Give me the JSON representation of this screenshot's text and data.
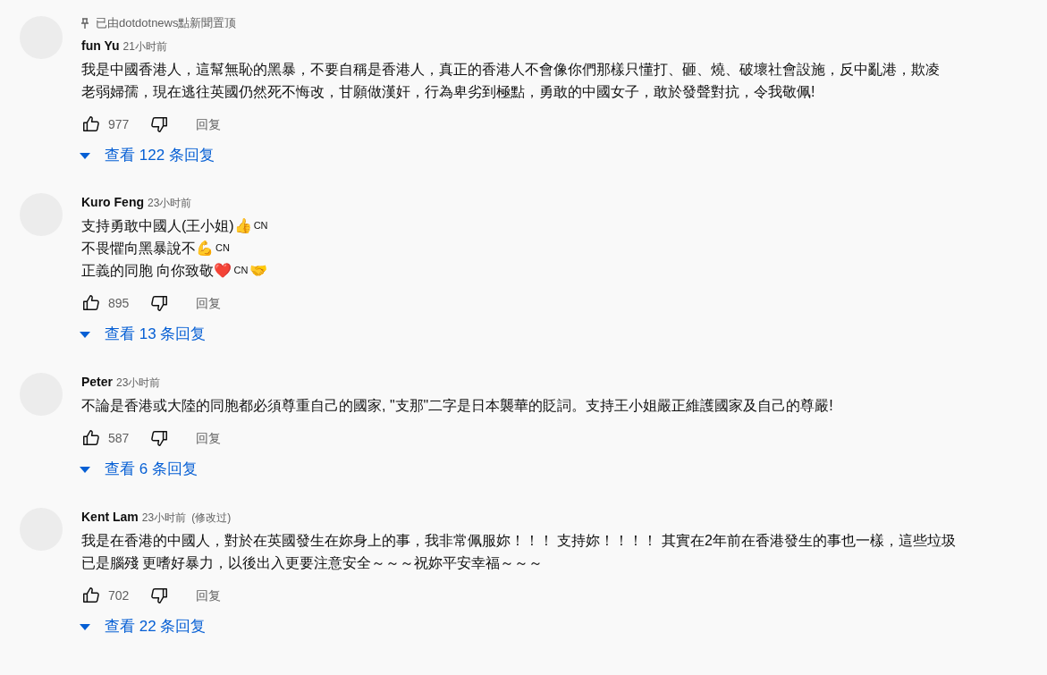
{
  "comments": [
    {
      "pinned_by": "已由dotdotnews點新聞置顶",
      "author": "fun Yu",
      "time": "21小时前",
      "lines": [
        [
          {
            "kind": "text",
            "text": "我是中國香港人，這幫無恥的黑暴，不要自稱是香港人，真正的香港人不會像你們那樣只懂打、砸、燒、破壞社會設施，反中亂港，欺凌"
          }
        ],
        [
          {
            "kind": "text",
            "text": "老弱婦孺，現在逃往英國仍然死不悔改，甘願做漢奸，行為卑劣到極點，勇敢的中國女子，敢於發聲對抗，令我敬佩!"
          }
        ]
      ],
      "likes": "977",
      "reply": "回复",
      "view_replies": "查看 122 条回复"
    },
    {
      "author": "Kuro Feng",
      "time": "23小时前",
      "lines": [
        [
          {
            "kind": "text",
            "text": "支持勇敢中國人(王小姐)👍"
          },
          {
            "kind": "flag",
            "text": "CN"
          }
        ],
        [
          {
            "kind": "text",
            "text": "不畏懼向黑暴說不💪"
          },
          {
            "kind": "flag",
            "text": "CN"
          }
        ],
        [
          {
            "kind": "text",
            "text": "正義的同胞 向你致敬❤️"
          },
          {
            "kind": "flag",
            "text": "CN"
          },
          {
            "kind": "text",
            "text": "🤝"
          }
        ]
      ],
      "likes": "895",
      "reply": "回复",
      "view_replies": "查看 13 条回复"
    },
    {
      "author": "Peter",
      "time": "23小时前",
      "lines": [
        [
          {
            "kind": "text",
            "text": "不論是香港或大陸的同胞都必須尊重自己的國家, \"支那\"二字是日本襲華的貶詞。支持王小姐嚴正維護國家及自己的尊嚴!"
          }
        ]
      ],
      "likes": "587",
      "reply": "回复",
      "view_replies": "查看 6 条回复"
    },
    {
      "author": "Kent Lam",
      "time": "23小时前",
      "edited": "(修改过)",
      "lines": [
        [
          {
            "kind": "text",
            "text": "我是在香港的中國人，對於在英國發生在妳身上的事，我非常佩服妳！！！ 支持妳！！！！ 其實在2年前在香港發生的事也一樣，這些垃圾"
          }
        ],
        [
          {
            "kind": "text",
            "text": "已是腦殘 更嗜好暴力，以後出入更要注意安全～～～祝妳平安幸福～～～"
          }
        ]
      ],
      "likes": "702",
      "reply": "回复",
      "view_replies": "查看 22 条回复"
    }
  ]
}
